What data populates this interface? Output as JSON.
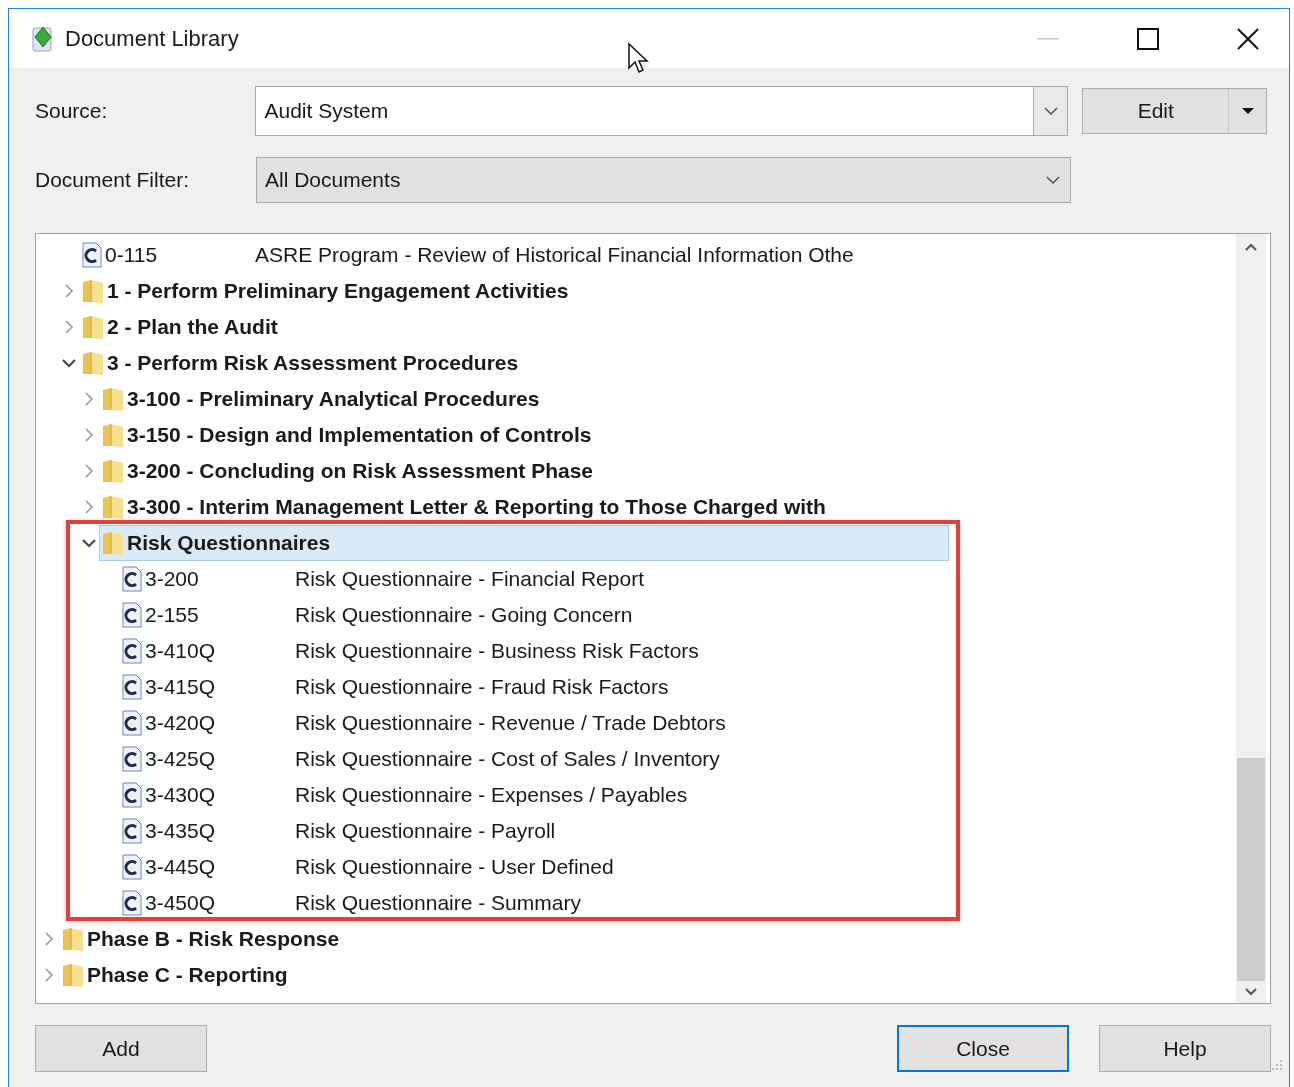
{
  "window": {
    "title": "Document Library"
  },
  "source": {
    "label": "Source:",
    "value": "Audit System"
  },
  "edit_button": {
    "label": "Edit"
  },
  "filter": {
    "label": "Document Filter:",
    "value": "All Documents"
  },
  "tree": {
    "items": [
      {
        "children": [
          {
            "kind": "document",
            "code": "0-115",
            "title": "ASRE Program - Review of Historical Financial Information Othe",
            "selected": false
          },
          {
            "kind": "folder",
            "label": "1 - Perform Preliminary Engagement Activities",
            "expanded": false,
            "selected": false
          },
          {
            "kind": "folder",
            "label": "2 - Plan the Audit",
            "expanded": false,
            "selected": false
          },
          {
            "kind": "folder",
            "label": "3 - Perform Risk Assessment Procedures",
            "expanded": true,
            "selected": false,
            "children": [
              {
                "kind": "folder",
                "label": "3-100 - Preliminary Analytical Procedures",
                "expanded": false,
                "selected": false
              },
              {
                "kind": "folder",
                "label": "3-150 - Design and Implementation of Controls",
                "expanded": false,
                "selected": false
              },
              {
                "kind": "folder",
                "label": "3-200 - Concluding on Risk Assessment Phase",
                "expanded": false,
                "selected": false
              },
              {
                "kind": "folder",
                "label": "3-300 - Interim Management Letter & Reporting to Those Charged with",
                "expanded": false,
                "selected": false
              },
              {
                "kind": "folder",
                "label": "Risk Questionnaires",
                "expanded": true,
                "selected": true,
                "children": [
                  {
                    "kind": "document",
                    "code": "3-200",
                    "title": "Risk Questionnaire - Financial Report",
                    "selected": false
                  },
                  {
                    "kind": "document",
                    "code": "2-155",
                    "title": "Risk Questionnaire - Going Concern",
                    "selected": false
                  },
                  {
                    "kind": "document",
                    "code": "3-410Q",
                    "title": "Risk Questionnaire - Business Risk Factors",
                    "selected": false
                  },
                  {
                    "kind": "document",
                    "code": "3-415Q",
                    "title": "Risk Questionnaire - Fraud Risk Factors",
                    "selected": false
                  },
                  {
                    "kind": "document",
                    "code": "3-420Q",
                    "title": "Risk Questionnaire - Revenue / Trade Debtors",
                    "selected": false
                  },
                  {
                    "kind": "document",
                    "code": "3-425Q",
                    "title": "Risk Questionnaire - Cost of Sales / Inventory",
                    "selected": false
                  },
                  {
                    "kind": "document",
                    "code": "3-430Q",
                    "title": "Risk Questionnaire - Expenses / Payables",
                    "selected": false
                  },
                  {
                    "kind": "document",
                    "code": "3-435Q",
                    "title": "Risk Questionnaire - Payroll",
                    "selected": false
                  },
                  {
                    "kind": "document",
                    "code": "3-445Q",
                    "title": "Risk Questionnaire - User Defined",
                    "selected": false
                  },
                  {
                    "kind": "document",
                    "code": "3-450Q",
                    "title": "Risk Questionnaire - Summary",
                    "selected": false
                  }
                ]
              }
            ]
          }
        ]
      },
      {
        "kind": "folder",
        "label": "Phase B - Risk Response",
        "expanded": false,
        "selected": false
      },
      {
        "kind": "folder",
        "label": "Phase C - Reporting",
        "expanded": false,
        "selected": false
      }
    ]
  },
  "buttons": [
    {
      "label": "Add",
      "default": false
    },
    {
      "label": "Close",
      "default": true
    },
    {
      "label": "Help",
      "default": false
    }
  ]
}
